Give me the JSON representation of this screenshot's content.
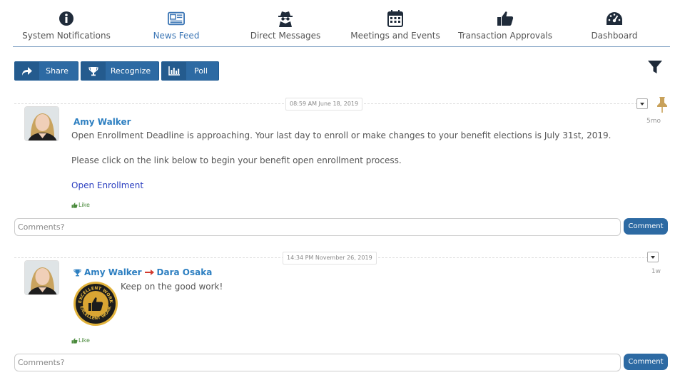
{
  "nav": {
    "items": [
      {
        "label": "System Notifications",
        "icon": "info-icon",
        "active": false
      },
      {
        "label": "News Feed",
        "icon": "newspaper-icon",
        "active": true
      },
      {
        "label": "Direct Messages",
        "icon": "spy-icon",
        "active": false
      },
      {
        "label": "Meetings and Events",
        "icon": "calendar-icon",
        "active": false
      },
      {
        "label": "Transaction Approvals",
        "icon": "thumbs-up-icon",
        "active": false
      },
      {
        "label": "Dashboard",
        "icon": "dashboard-gauge-icon",
        "active": false
      }
    ]
  },
  "actions": {
    "share_label": "Share",
    "recognize_label": "Recognize",
    "poll_label": "Poll"
  },
  "colors": {
    "primary": "#2d6aa3",
    "link": "#2d7fc1",
    "like": "#4a8a3c",
    "pin": "#c8a15a"
  },
  "posts": [
    {
      "timestamp": "08:59 AM June 18, 2019",
      "author": "Amy Walker",
      "age": "5mo",
      "text1": "Open Enrollment Deadline is approaching. Your last day to enroll or make changes to your benefit elections is July 31st, 2019.",
      "text2": "Please click on the link below to begin your benefit open enrollment process.",
      "link": "Open Enrollment",
      "like_label": "Like",
      "comment_placeholder": "Comments?",
      "comment_button": "Comment"
    },
    {
      "timestamp": "14:34 PM November 26, 2019",
      "author": "Amy Walker",
      "recipient": "Dara Osaka",
      "age": "1w",
      "text1": "Keep on the good work!",
      "badge_text": "EXCELLENT WORK",
      "like_label": "Like",
      "comment_placeholder": "Comments?",
      "comment_button": "Comment"
    }
  ]
}
